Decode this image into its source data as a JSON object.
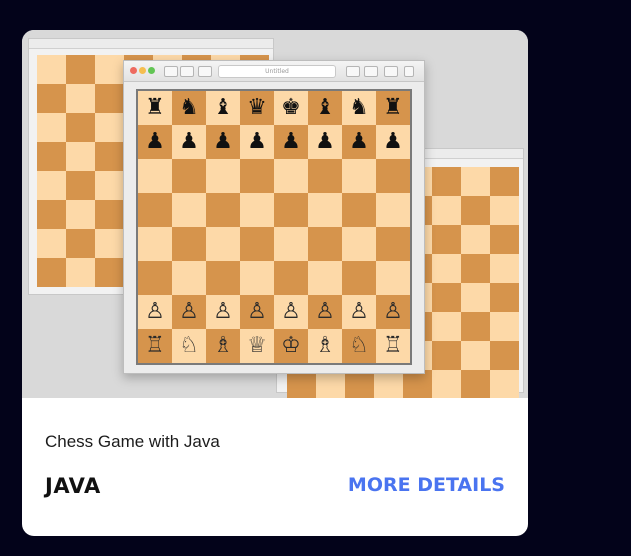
{
  "card": {
    "title": "Chess Game with Java",
    "language": "JAVA",
    "details_label": "MORE DETAILS"
  },
  "colors": {
    "page_background": "#03031a",
    "card_background": "#ffffff",
    "accent_link": "#4a74f0",
    "board_light": "#fdd9a8",
    "board_dark": "#d6944c"
  },
  "chess_window": {
    "window_title": "Untitled",
    "board_rows": [
      [
        "♜",
        "♞",
        "♝",
        "♛",
        "♚",
        "♝",
        "♞",
        "♜"
      ],
      [
        "♟",
        "♟",
        "♟",
        "♟",
        "♟",
        "♟",
        "♟",
        "♟"
      ],
      [
        "",
        "",
        "",
        "",
        "",
        "",
        "",
        ""
      ],
      [
        "",
        "",
        "",
        "",
        "",
        "",
        "",
        ""
      ],
      [
        "",
        "",
        "",
        "",
        "",
        "",
        "",
        ""
      ],
      [
        "",
        "",
        "",
        "",
        "",
        "",
        "",
        ""
      ],
      [
        "♙",
        "♙",
        "♙",
        "♙",
        "♙",
        "♙",
        "♙",
        "♙"
      ],
      [
        "♖",
        "♘",
        "♗",
        "♕",
        "♔",
        "♗",
        "♘",
        "♖"
      ]
    ]
  }
}
